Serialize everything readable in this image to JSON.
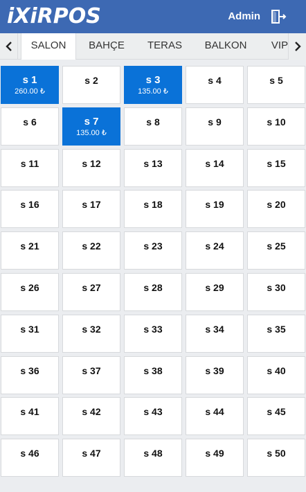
{
  "header": {
    "logo_text": "iXiRPOS",
    "user_label": "Admin",
    "logout_icon": "logout-icon",
    "brand_color": "#3d69b3"
  },
  "areas": {
    "left_arrow_icon": "chevron-left-icon",
    "right_arrow_icon": "chevron-right-icon",
    "tabs": [
      {
        "label": "SALON",
        "active": true
      },
      {
        "label": "BAHÇE",
        "active": false
      },
      {
        "label": "TERAS",
        "active": false
      },
      {
        "label": "BALKON",
        "active": false
      },
      {
        "label": "VIP",
        "active": false
      }
    ]
  },
  "tables": {
    "occupied_color": "#0a72d8",
    "items": [
      {
        "name": "s 1",
        "amount": "260.00 ₺",
        "occupied": true
      },
      {
        "name": "s 2",
        "amount": "",
        "occupied": false
      },
      {
        "name": "s 3",
        "amount": "135.00 ₺",
        "occupied": true
      },
      {
        "name": "s 4",
        "amount": "",
        "occupied": false
      },
      {
        "name": "s 5",
        "amount": "",
        "occupied": false
      },
      {
        "name": "s 6",
        "amount": "",
        "occupied": false
      },
      {
        "name": "s 7",
        "amount": "135.00 ₺",
        "occupied": true
      },
      {
        "name": "s 8",
        "amount": "",
        "occupied": false
      },
      {
        "name": "s 9",
        "amount": "",
        "occupied": false
      },
      {
        "name": "s 10",
        "amount": "",
        "occupied": false
      },
      {
        "name": "s 11",
        "amount": "",
        "occupied": false
      },
      {
        "name": "s 12",
        "amount": "",
        "occupied": false
      },
      {
        "name": "s 13",
        "amount": "",
        "occupied": false
      },
      {
        "name": "s 14",
        "amount": "",
        "occupied": false
      },
      {
        "name": "s 15",
        "amount": "",
        "occupied": false
      },
      {
        "name": "s 16",
        "amount": "",
        "occupied": false
      },
      {
        "name": "s 17",
        "amount": "",
        "occupied": false
      },
      {
        "name": "s 18",
        "amount": "",
        "occupied": false
      },
      {
        "name": "s 19",
        "amount": "",
        "occupied": false
      },
      {
        "name": "s 20",
        "amount": "",
        "occupied": false
      },
      {
        "name": "s 21",
        "amount": "",
        "occupied": false
      },
      {
        "name": "s 22",
        "amount": "",
        "occupied": false
      },
      {
        "name": "s 23",
        "amount": "",
        "occupied": false
      },
      {
        "name": "s 24",
        "amount": "",
        "occupied": false
      },
      {
        "name": "s 25",
        "amount": "",
        "occupied": false
      },
      {
        "name": "s 26",
        "amount": "",
        "occupied": false
      },
      {
        "name": "s 27",
        "amount": "",
        "occupied": false
      },
      {
        "name": "s 28",
        "amount": "",
        "occupied": false
      },
      {
        "name": "s 29",
        "amount": "",
        "occupied": false
      },
      {
        "name": "s 30",
        "amount": "",
        "occupied": false
      },
      {
        "name": "s 31",
        "amount": "",
        "occupied": false
      },
      {
        "name": "s 32",
        "amount": "",
        "occupied": false
      },
      {
        "name": "s 33",
        "amount": "",
        "occupied": false
      },
      {
        "name": "s 34",
        "amount": "",
        "occupied": false
      },
      {
        "name": "s 35",
        "amount": "",
        "occupied": false
      },
      {
        "name": "s 36",
        "amount": "",
        "occupied": false
      },
      {
        "name": "s 37",
        "amount": "",
        "occupied": false
      },
      {
        "name": "s 38",
        "amount": "",
        "occupied": false
      },
      {
        "name": "s 39",
        "amount": "",
        "occupied": false
      },
      {
        "name": "s 40",
        "amount": "",
        "occupied": false
      },
      {
        "name": "s 41",
        "amount": "",
        "occupied": false
      },
      {
        "name": "s 42",
        "amount": "",
        "occupied": false
      },
      {
        "name": "s 43",
        "amount": "",
        "occupied": false
      },
      {
        "name": "s 44",
        "amount": "",
        "occupied": false
      },
      {
        "name": "s 45",
        "amount": "",
        "occupied": false
      },
      {
        "name": "s 46",
        "amount": "",
        "occupied": false
      },
      {
        "name": "s 47",
        "amount": "",
        "occupied": false
      },
      {
        "name": "s 48",
        "amount": "",
        "occupied": false
      },
      {
        "name": "s 49",
        "amount": "",
        "occupied": false
      },
      {
        "name": "s 50",
        "amount": "",
        "occupied": false
      }
    ]
  }
}
